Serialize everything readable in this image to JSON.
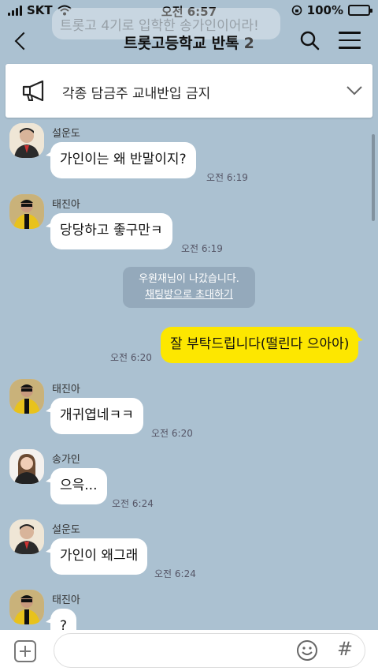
{
  "status_bar": {
    "carrier": "SKT",
    "time": "오전 6:57",
    "battery_percent": "100%",
    "battery_level": 1.0
  },
  "header": {
    "ghost_message": "트롯고 4기로 입학한 송가인이어라!",
    "title": "트롯고등학교 반톡",
    "member_count": "2"
  },
  "notice": {
    "text": "각종 담금주 교내반입 금지"
  },
  "messages": [
    {
      "sender": "설운도",
      "text": "가인이는 왜 반말이지?",
      "time": "오전 6:19"
    },
    {
      "sender": "태진아",
      "text": "당당하고 좋구만ㅋ",
      "time": "오전 6:19"
    },
    {
      "system_line1": "우원재님이 나갔습니다.",
      "system_link": "채팅방으로 초대하기"
    },
    {
      "sender": "me",
      "text": "잘 부탁드립니다(떨린다 으아아)",
      "time": "오전 6:20"
    },
    {
      "sender": "태진아",
      "text": "개귀엽네ㅋㅋ",
      "time": "오전 6:20"
    },
    {
      "sender": "송가인",
      "text": "으윽...",
      "time": "오전 6:24"
    },
    {
      "sender": "설운도",
      "text": "가인이 왜그래",
      "time": "오전 6:24"
    },
    {
      "sender": "태진아",
      "text": "?",
      "time": ""
    }
  ],
  "input_bar": {
    "placeholder": "",
    "hash_label": "#"
  },
  "colors": {
    "background": "#abc1d1",
    "my_bubble": "#fde700",
    "other_bubble": "#ffffff",
    "battery": "#3dc33d"
  },
  "icons": [
    "back-arrow-icon",
    "search-icon",
    "menu-icon",
    "megaphone-icon",
    "chevron-down-icon",
    "plus-icon",
    "emoji-icon"
  ]
}
